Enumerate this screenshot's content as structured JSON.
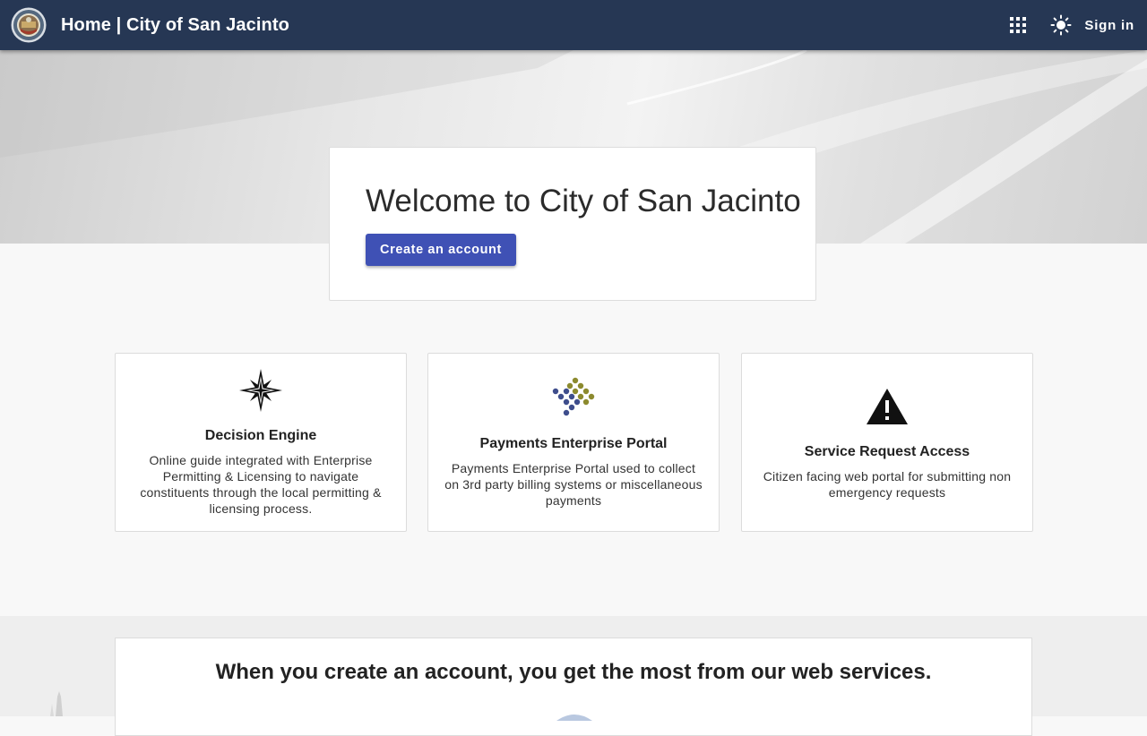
{
  "header": {
    "title": "Home | City of San Jacinto",
    "apps_icon": "apps-grid-icon",
    "theme_icon": "sun-icon",
    "signin_label": "Sign in",
    "bg_color": "#263754"
  },
  "hero": {
    "welcome_title": "Welcome to City of San Jacinto",
    "create_account_label": "Create an account",
    "button_color": "#3f51b5"
  },
  "services": [
    {
      "icon": "compass-star-icon",
      "title": "Decision Engine",
      "description": "Online guide integrated with Enterprise Permitting & Licensing to navigate constituents through the local permitting & licensing process."
    },
    {
      "icon": "payments-dots-icon",
      "title": "Payments Enterprise Portal",
      "description": "Payments Enterprise Portal used to collect on 3rd party billing systems or miscellaneous payments"
    },
    {
      "icon": "warning-triangle-icon",
      "title": "Service Request Access",
      "description": "Citizen facing web portal for submitting non emergency requests"
    }
  ],
  "benefits": {
    "title": "When you create an account, you get the most from our web services."
  }
}
